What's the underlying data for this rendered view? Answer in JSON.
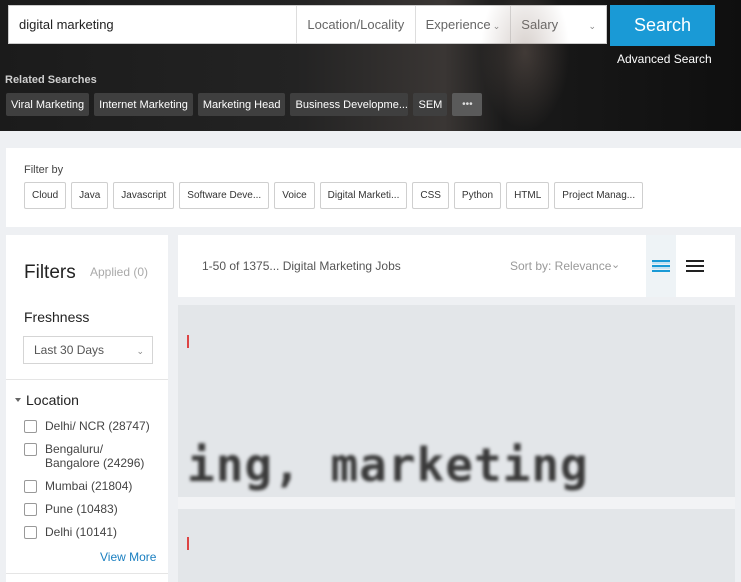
{
  "search": {
    "keyword": "digital marketing",
    "location_placeholder": "Location/Locality",
    "experience_placeholder": "Experience",
    "salary_placeholder": "Salary",
    "button_label": "Search",
    "advanced_label": "Advanced Search"
  },
  "related": {
    "title": "Related Searches",
    "items": [
      "Viral Marketing",
      "Internet Marketing",
      "Marketing Head",
      "Business Developme...",
      "SEM"
    ],
    "more": "•••"
  },
  "filter_by": {
    "title": "Filter by",
    "chips": [
      "Cloud",
      "Java",
      "Javascript",
      "Software Deve...",
      "Voice",
      "Digital Marketi...",
      "CSS",
      "Python",
      "HTML",
      "Project Manag..."
    ]
  },
  "filters": {
    "title": "Filters",
    "applied": "Applied (0)",
    "freshness_title": "Freshness",
    "freshness_value": "Last 30 Days",
    "location_title": "Location",
    "locations": [
      {
        "label": "Delhi/ NCR (28747)"
      },
      {
        "label": "Bengaluru/\nBangalore (24296)"
      },
      {
        "label": "Mumbai (21804)"
      },
      {
        "label": "Pune (10483)"
      },
      {
        "label": "Delhi (10141)"
      }
    ],
    "view_more": "View More"
  },
  "results": {
    "count": "1-50 of 1375... Digital Marketing Jobs",
    "sort": "Sort by: Relevance"
  },
  "banner": {
    "text": "ing, marketing"
  },
  "colors": {
    "accent": "#1a9ad6",
    "link": "#1a7fc0"
  }
}
